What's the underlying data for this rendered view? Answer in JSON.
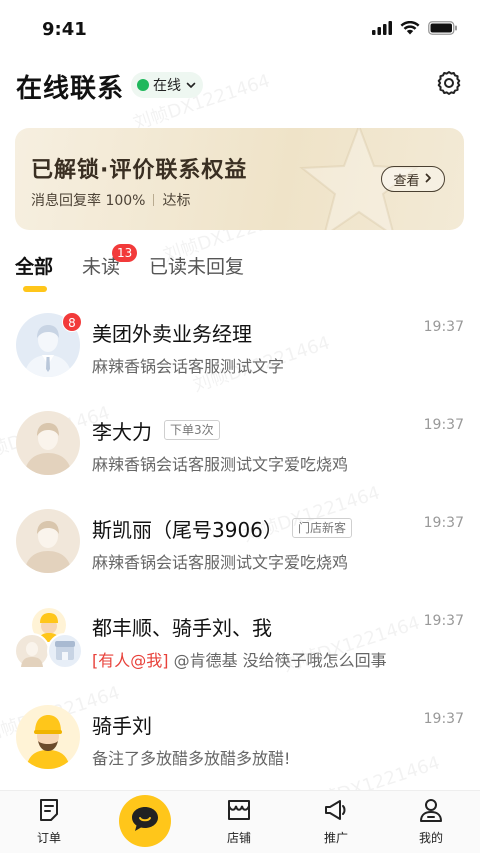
{
  "status_bar": {
    "time": "9:41"
  },
  "header": {
    "title": "在线联系",
    "status_label": "在线"
  },
  "banner": {
    "title": "已解锁·评价联系权益",
    "reply_rate": "消息回复率 100%",
    "standard": "达标",
    "button_label": "查看"
  },
  "tabs": [
    {
      "label": "全部",
      "active": true
    },
    {
      "label": "未读",
      "badge": "13"
    },
    {
      "label": "已读未回复"
    }
  ],
  "conversations": [
    {
      "name": "美团外卖业务经理",
      "message": "麻辣香锅会话客服测试文字",
      "time": "19:37",
      "badge": "8",
      "avatar": "manager-avatar"
    },
    {
      "name": "李大力",
      "tag": "下单3次",
      "message": "麻辣香锅会话客服测试文字爱吃烧鸡",
      "time": "19:37",
      "avatar": "user-avatar"
    },
    {
      "name": "斯凯丽（尾号3906）",
      "tag": "门店新客",
      "message": "麻辣香锅会话客服测试文字爱吃烧鸡",
      "time": "19:37",
      "avatar": "user-avatar"
    },
    {
      "name": "都丰顺、骑手刘、我",
      "mention": "[有人@我]",
      "message": "@肯德基 没给筷子哦怎么回事",
      "time": "19:37",
      "avatar": "group-avatar"
    },
    {
      "name": "骑手刘",
      "message": "备注了多放醋多放醋多放醋!",
      "time": "19:37",
      "avatar": "rider-avatar"
    }
  ],
  "tabbar": [
    {
      "label": "订单",
      "icon": "order-icon"
    },
    {
      "label": "",
      "icon": "chat-icon"
    },
    {
      "label": "店铺",
      "icon": "store-icon"
    },
    {
      "label": "推广",
      "icon": "promote-icon"
    },
    {
      "label": "我的",
      "icon": "profile-icon"
    }
  ],
  "watermark": "刘帧DX1221464",
  "colors": {
    "accent": "#ffc61a",
    "online": "#1fb85c",
    "badge": "#f23a3a",
    "mention": "#e8413a"
  }
}
